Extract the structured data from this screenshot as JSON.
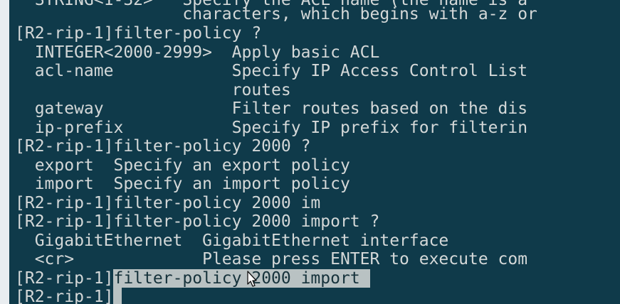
{
  "terminal": {
    "lines": [
      "  STRING<1-32>   Specify the ACL name (the name is a",
      "                 characters, which begins with a-z or",
      "[R2-rip-1]filter-policy ?",
      "  INTEGER<2000-2999>  Apply basic ACL",
      "  acl-name            Specify IP Access Control List",
      "                      routes",
      "  gateway             Filter routes based on the dis",
      "  ip-prefix           Specify IP prefix for filterin",
      "[R2-rip-1]filter-policy 2000 ?",
      "  export  Specify an export policy",
      "  import  Specify an import policy",
      "[R2-rip-1]filter-policy 2000 im",
      "[R2-rip-1]filter-policy 2000 import ?",
      "  GigabitEthernet  GigabitEthernet interface",
      "  <cr>             Please press ENTER to execute com"
    ],
    "selected_line": {
      "prompt": "[R2-rip-1]",
      "highlighted": "filter-policy 2000 import "
    },
    "current_prompt": "[R2-rip-1]"
  },
  "colors": {
    "background": "#0f3a4a",
    "text": "#d4d8d8",
    "selection": "#b9c2c3"
  },
  "icons": {
    "pointer": "mouse-pointer-icon"
  }
}
